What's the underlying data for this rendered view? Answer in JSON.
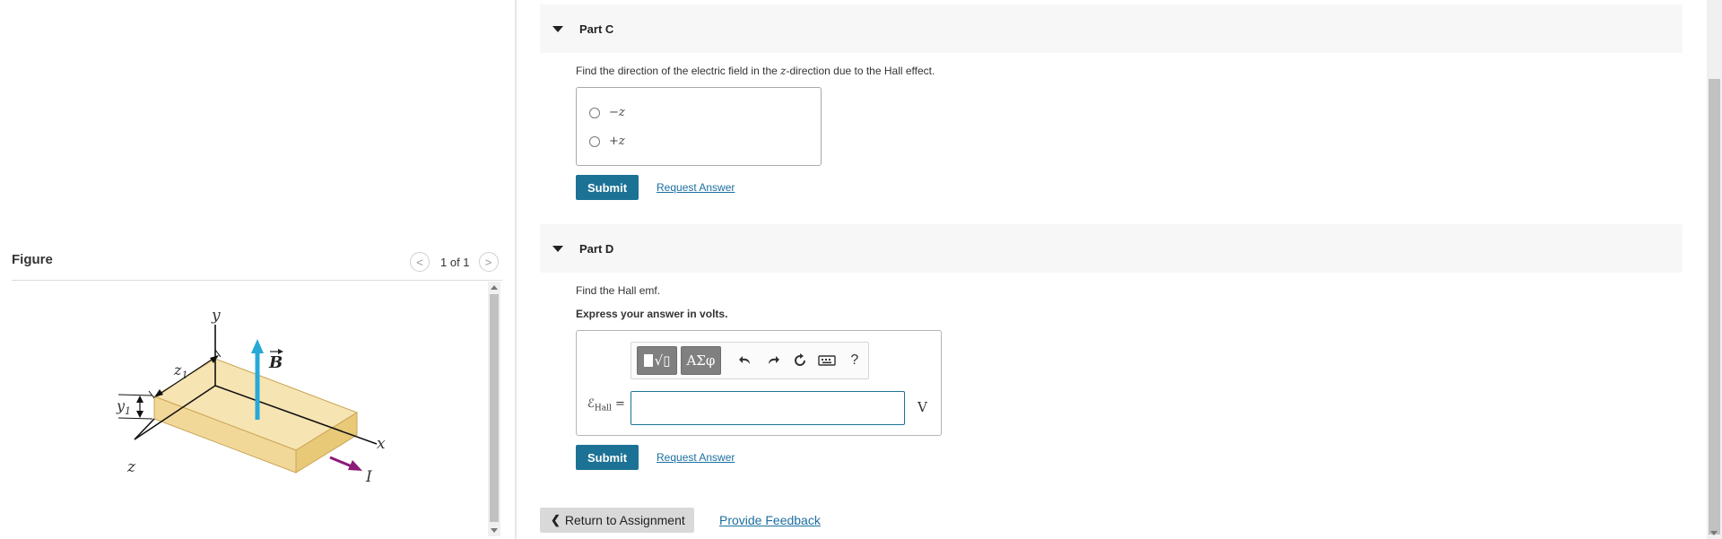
{
  "figure_panel": {
    "title": "Figure",
    "pager_text": "1 of 1",
    "prev_glyph": "<",
    "next_glyph": ">",
    "diagram_labels": {
      "y": "y",
      "x": "x",
      "z": "z",
      "z1": "z",
      "z1_sub": "1",
      "y1": "y",
      "y1_sub": "1",
      "B": "B",
      "I": "I"
    },
    "colors": {
      "slab_top": "#f7e4b3",
      "slab_front": "#f2d898",
      "slab_side": "#e8c978",
      "b_arrow": "#29a8d8",
      "i_arrow": "#8b1a7a"
    }
  },
  "partC": {
    "title": "Part C",
    "prompt_pre": "Find the direction of the electric field in the ",
    "prompt_var": "z",
    "prompt_post": "-direction due to the Hall effect.",
    "choices": [
      "−z",
      "+z"
    ],
    "submit_label": "Submit",
    "request_label": "Request Answer"
  },
  "partD": {
    "title": "Part D",
    "prompt": "Find the Hall emf.",
    "instruction": "Express your answer in volts.",
    "toolbar": {
      "templates_icon": "templates-icon",
      "greek_label": "ΑΣφ",
      "undo_icon": "undo-icon",
      "redo_icon": "redo-icon",
      "reset_icon": "reset-icon",
      "keyboard_icon": "keyboard-icon",
      "help_label": "?"
    },
    "answer_symbol": "ℰ",
    "answer_subscript": "Hall",
    "answer_equals": " =",
    "answer_value": "",
    "unit": "V",
    "submit_label": "Submit",
    "request_label": "Request Answer"
  },
  "footer": {
    "return_label": "Return to Assignment",
    "feedback_label": "Provide Feedback"
  },
  "colors": {
    "accent": "#1c7295",
    "link": "#1c6fa0",
    "header_bg": "#f7f7f7"
  }
}
